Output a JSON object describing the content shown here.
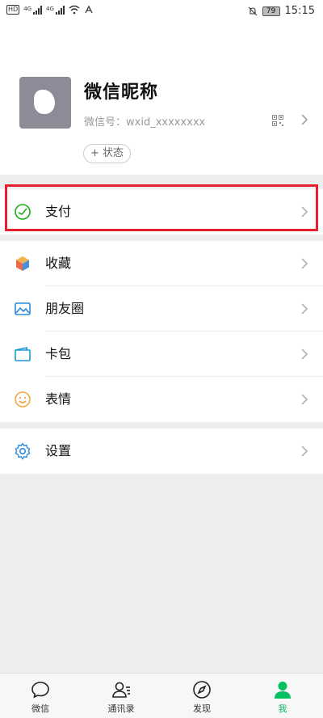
{
  "status_bar": {
    "hd_label": "HD",
    "network_1": "4G",
    "network_2": "4G",
    "battery": "79",
    "time": "15:15"
  },
  "profile": {
    "nickname": "微信昵称",
    "wechat_id": "微信号：wxid_xxxxxxxx",
    "status_button": "+ 状态"
  },
  "menu": {
    "pay": "支付",
    "favorites": "收藏",
    "moments": "朋友圈",
    "cards": "卡包",
    "stickers": "表情",
    "settings": "设置"
  },
  "tabs": [
    {
      "label": "微信",
      "icon": "chat-icon"
    },
    {
      "label": "通讯录",
      "icon": "contacts-icon"
    },
    {
      "label": "发现",
      "icon": "compass-icon"
    },
    {
      "label": "我",
      "icon": "me-icon"
    }
  ],
  "colors": {
    "accent_green": "#07c160",
    "highlight_red": "#e5202f",
    "background": "#ededed"
  }
}
